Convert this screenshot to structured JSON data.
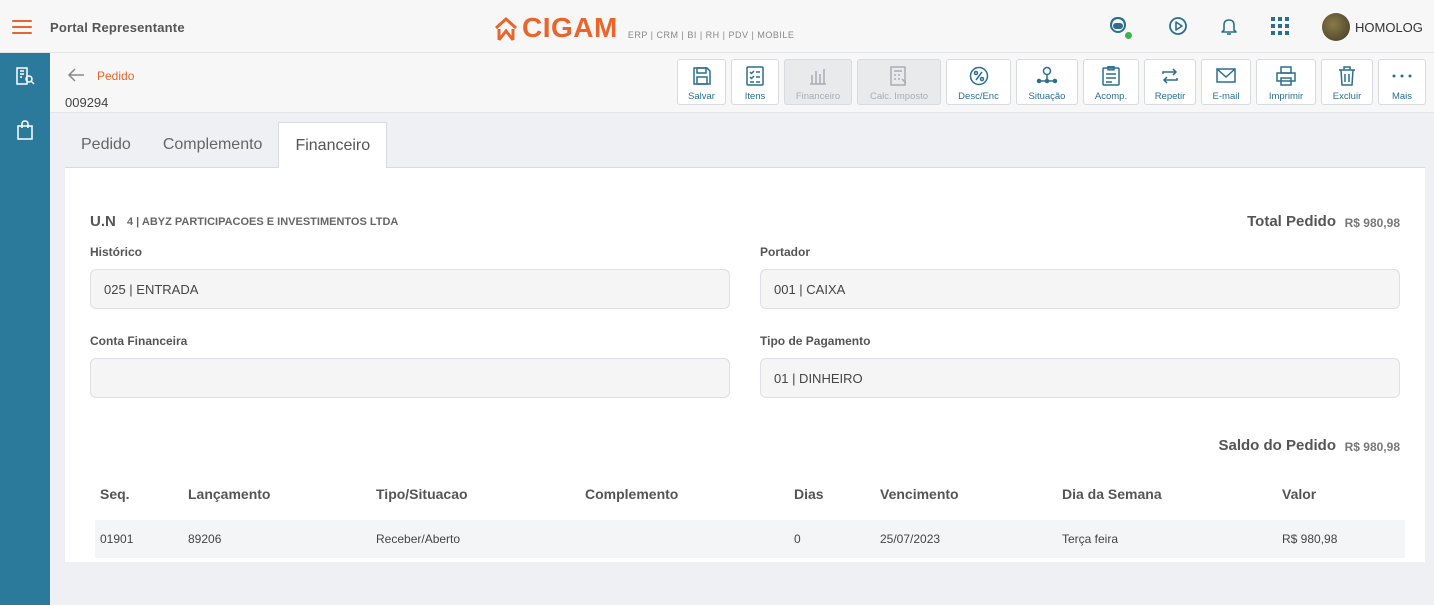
{
  "topbar": {
    "app_title": "Portal Representante",
    "logo_text": "CIGAM",
    "logo_sub": "ERP | CRM | BI | RH | PDV | MOBILE",
    "user_name": "HOMOLOG",
    "accent_color": "#e8652b",
    "status_color": "#3bb54a"
  },
  "sidebar": {
    "color": "#2b7a9b"
  },
  "subheader": {
    "breadcrumb": "Pedido",
    "order_number": "009294"
  },
  "toolbar": {
    "items": [
      {
        "label": "Salvar",
        "icon": "save-icon",
        "disabled": false
      },
      {
        "label": "Itens",
        "icon": "checklist-icon",
        "disabled": false
      },
      {
        "label": "Financeiro",
        "icon": "finance-icon",
        "disabled": true
      },
      {
        "label": "Calc. Imposto",
        "icon": "calculator-icon",
        "disabled": true
      },
      {
        "label": "Desc/Enc",
        "icon": "percent-icon",
        "disabled": false
      },
      {
        "label": "Situação",
        "icon": "status-icon",
        "disabled": false
      },
      {
        "label": "Acomp.",
        "icon": "tracking-icon",
        "disabled": false
      },
      {
        "label": "Repetir",
        "icon": "repeat-icon",
        "disabled": false
      },
      {
        "label": "E-mail",
        "icon": "mail-icon",
        "disabled": false
      },
      {
        "label": "Imprimir",
        "icon": "print-icon",
        "disabled": false
      },
      {
        "label": "Excluir",
        "icon": "trash-icon",
        "disabled": false
      },
      {
        "label": "Mais",
        "icon": "more-icon",
        "disabled": false
      }
    ]
  },
  "tabs": [
    {
      "label": "Pedido",
      "active": false
    },
    {
      "label": "Complemento",
      "active": false
    },
    {
      "label": "Financeiro",
      "active": true
    }
  ],
  "financeiro": {
    "un_label": "U.N",
    "un_value": "4 | ABYZ PARTICIPACOES E INVESTIMENTOS LTDA",
    "total_label": "Total Pedido",
    "total_value": "R$ 980,98",
    "historico_label": "Histórico",
    "historico_value": "025 | ENTRADA",
    "portador_label": "Portador",
    "portador_value": "001 | CAIXA",
    "conta_label": "Conta Financeira",
    "conta_value": "",
    "tipo_pag_label": "Tipo de Pagamento",
    "tipo_pag_value": "01 | DINHEIRO",
    "saldo_label": "Saldo do Pedido",
    "saldo_value": "R$ 980,98"
  },
  "table": {
    "headers": [
      "Seq.",
      "Lançamento",
      "Tipo/Situacao",
      "Complemento",
      "Dias",
      "Vencimento",
      "Dia da Semana",
      "Valor"
    ],
    "rows": [
      [
        "01901",
        "89206",
        "Receber/Aberto",
        "",
        "0",
        "25/07/2023",
        "Terça feira",
        "R$ 980,98"
      ]
    ]
  }
}
